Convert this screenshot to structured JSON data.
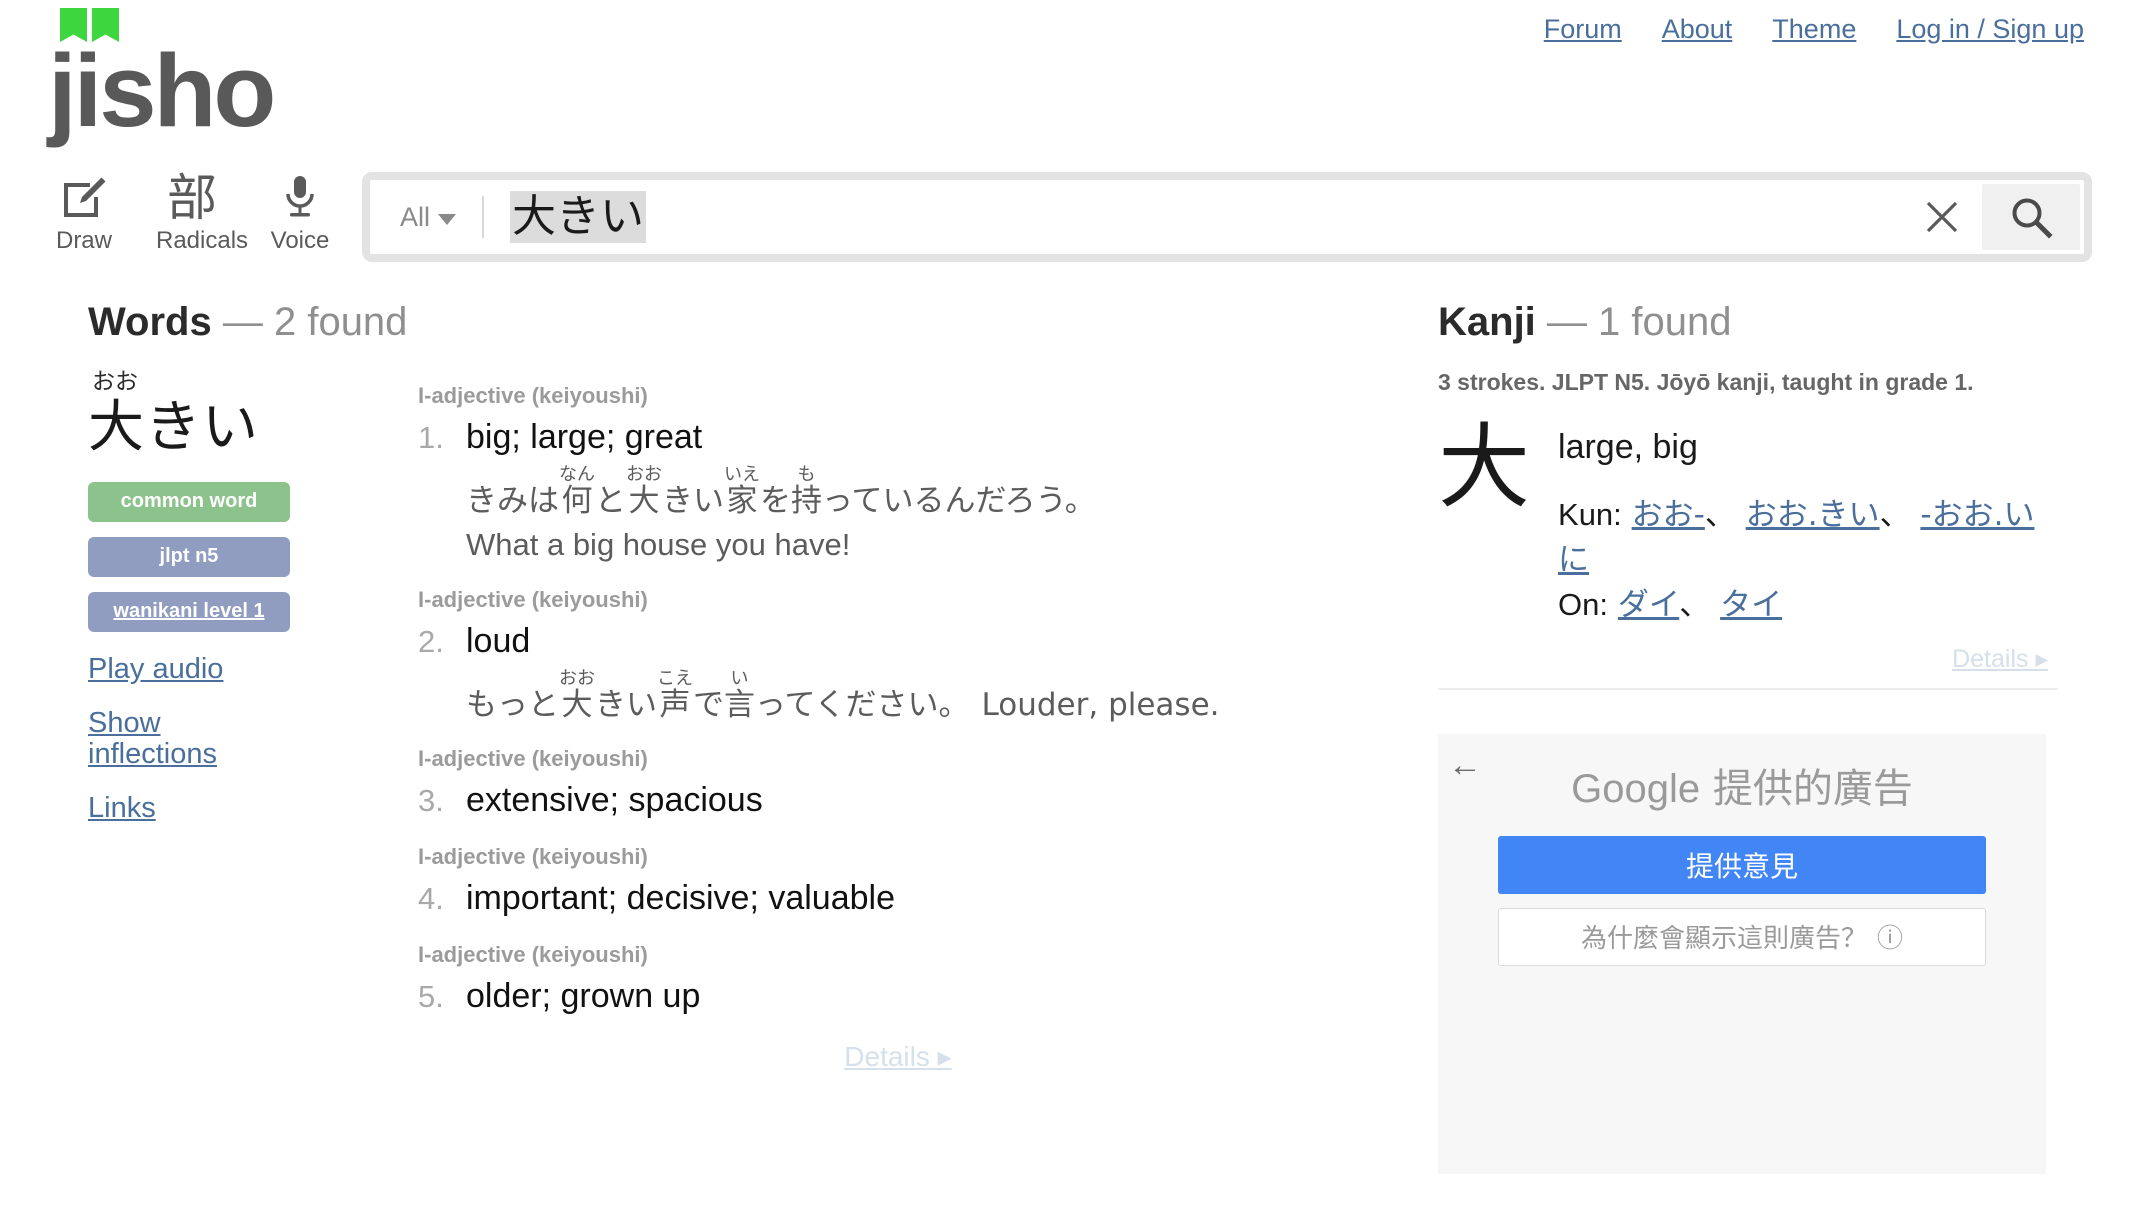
{
  "brand": {
    "name": "jisho",
    "logo_icon": "open-book-icon",
    "logo_color": "#3ed63e"
  },
  "topnav": [
    {
      "label": "Forum"
    },
    {
      "label": "About"
    },
    {
      "label": "Theme"
    },
    {
      "label": "Log in / Sign up"
    }
  ],
  "tools": [
    {
      "label": "Draw",
      "icon": "draw-pencil-icon"
    },
    {
      "label": "Radicals",
      "icon": "radicals-icon",
      "glyph": "部"
    },
    {
      "label": "Voice",
      "icon": "microphone-icon"
    }
  ],
  "search": {
    "scope_label": "All",
    "scope_caret": "chevron-down-icon",
    "query": "大きい",
    "placeholder": "",
    "clear_icon": "close-icon",
    "search_icon": "search-icon"
  },
  "words": {
    "heading": "Words",
    "dash": "—",
    "count_label": "2 found",
    "entry": {
      "furigana": "おお",
      "word": "大きい",
      "badges": [
        {
          "label": "common word",
          "style": "green",
          "link": false
        },
        {
          "label": "jlpt n5",
          "style": "blue",
          "link": false
        },
        {
          "label": "wanikani level 1",
          "style": "blue",
          "link": true
        }
      ],
      "links": [
        {
          "label": "Play audio"
        },
        {
          "label": "Show inflections"
        },
        {
          "label": "Links"
        }
      ],
      "senses": [
        {
          "pos": "I-adjective (keiyoushi)",
          "num": "1.",
          "definition": "big; large; great",
          "example_jp_parts": [
            {
              "rb": "きみは",
              "rt": ""
            },
            {
              "rb": "何",
              "rt": "なん"
            },
            {
              "rb": "と",
              "rt": ""
            },
            {
              "rb": "大",
              "rt": "おお"
            },
            {
              "rb": "きい",
              "rt": ""
            },
            {
              "rb": "家",
              "rt": "いえ"
            },
            {
              "rb": " を",
              "rt": ""
            },
            {
              "rb": "持",
              "rt": "も"
            },
            {
              "rb": "っているんだろう。",
              "rt": ""
            }
          ],
          "example_en": "What a big house you have!",
          "example_en_inline": ""
        },
        {
          "pos": "I-adjective (keiyoushi)",
          "num": "2.",
          "definition": "loud",
          "example_jp_parts": [
            {
              "rb": "もっと",
              "rt": ""
            },
            {
              "rb": "大",
              "rt": "おお"
            },
            {
              "rb": "きい",
              "rt": ""
            },
            {
              "rb": "声",
              "rt": "こえ"
            },
            {
              "rb": " で",
              "rt": ""
            },
            {
              "rb": "言",
              "rt": "い"
            },
            {
              "rb": "ってください。",
              "rt": ""
            }
          ],
          "example_en": "",
          "example_en_inline": "Louder, please."
        },
        {
          "pos": "I-adjective (keiyoushi)",
          "num": "3.",
          "definition": "extensive; spacious",
          "example_jp_parts": [],
          "example_en": "",
          "example_en_inline": ""
        },
        {
          "pos": "I-adjective (keiyoushi)",
          "num": "4.",
          "definition": "important; decisive; valuable",
          "example_jp_parts": [],
          "example_en": "",
          "example_en_inline": ""
        },
        {
          "pos": "I-adjective (keiyoushi)",
          "num": "5.",
          "definition": "older; grown up",
          "example_jp_parts": [],
          "example_en": "",
          "example_en_inline": ""
        }
      ],
      "details_label": "Details ▸"
    }
  },
  "kanji": {
    "heading": "Kanji",
    "dash": "—",
    "count_label": "1 found",
    "meta": "3 strokes. JLPT N5. Jōyō kanji, taught in grade 1.",
    "character": "大",
    "meaning": "large, big",
    "kun_label": "Kun:",
    "kun_readings": [
      "おお-",
      "おお.きい",
      "-おお.いに"
    ],
    "on_label": "On:",
    "on_readings": [
      "ダイ",
      "タイ"
    ],
    "separator": "、",
    "details_label": "Details ▸"
  },
  "ad": {
    "back_icon": "back-arrow-icon",
    "title_brand": "Google",
    "title_rest": " 提供的廣告",
    "primary_button": "提供意見",
    "secondary_button": "為什麼會顯示這則廣告？",
    "info_icon": "ⓘ",
    "primary_color": "#4285f4"
  }
}
